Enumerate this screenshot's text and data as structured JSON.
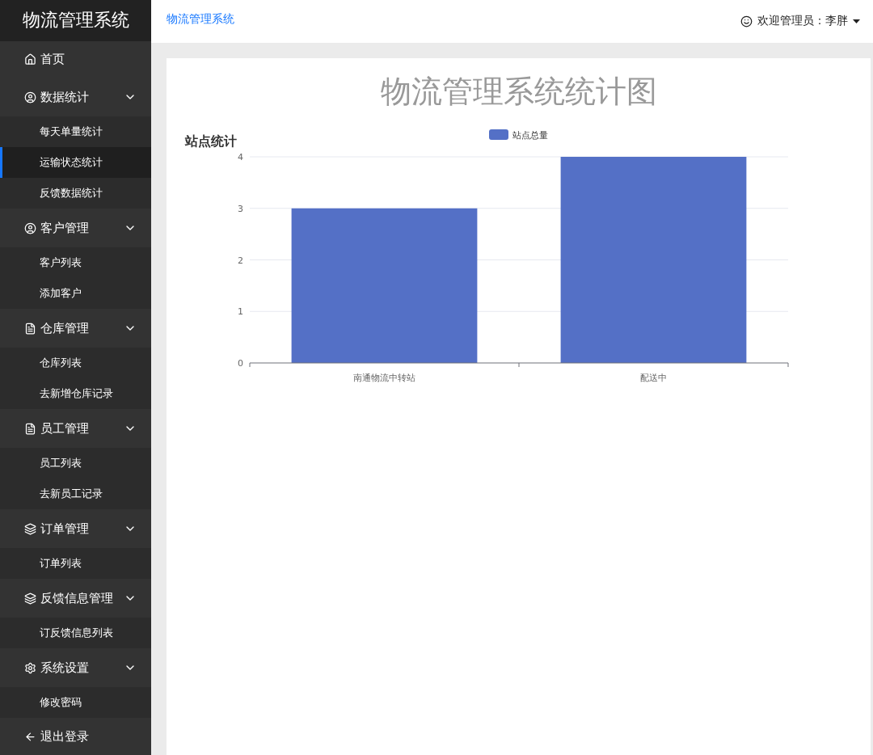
{
  "sidebar": {
    "logo": "物流管理系统",
    "items": [
      {
        "kind": "link",
        "label": "首页"
      },
      {
        "kind": "group",
        "label": "数据统计",
        "expanded": true,
        "children": [
          {
            "label": "每天单量统计",
            "selected": false
          },
          {
            "label": "运输状态统计",
            "selected": true
          },
          {
            "label": "反馈数据统计",
            "selected": false
          }
        ]
      },
      {
        "kind": "group",
        "label": "客户管理",
        "expanded": true,
        "children": [
          {
            "label": "客户列表",
            "selected": false
          },
          {
            "label": "添加客户",
            "selected": false
          }
        ]
      },
      {
        "kind": "group",
        "label": "仓库管理",
        "expanded": true,
        "children": [
          {
            "label": "仓库列表",
            "selected": false
          },
          {
            "label": "去新增仓库记录",
            "selected": false
          }
        ]
      },
      {
        "kind": "group",
        "label": "员工管理",
        "expanded": true,
        "children": [
          {
            "label": "员工列表",
            "selected": false
          },
          {
            "label": "去新员工记录",
            "selected": false
          }
        ]
      },
      {
        "kind": "group",
        "label": "订单管理",
        "expanded": true,
        "children": [
          {
            "label": "订单列表",
            "selected": false
          }
        ]
      },
      {
        "kind": "group",
        "label": "反馈信息管理",
        "expanded": true,
        "children": [
          {
            "label": "订反馈信息列表",
            "selected": false
          }
        ]
      },
      {
        "kind": "group",
        "label": "系统设置",
        "expanded": true,
        "children": [
          {
            "label": "修改密码",
            "selected": false
          }
        ]
      },
      {
        "kind": "link",
        "label": "退出登录"
      }
    ]
  },
  "header": {
    "breadcrumb": "物流管理系统",
    "user": "欢迎管理员：李胖"
  },
  "page": {
    "title": "物流管理系统统计图",
    "chart_data": {
      "type": "bar",
      "title": "站点统计",
      "categories": [
        "南通物流中转站",
        "配送中"
      ],
      "series": [
        {
          "name": "站点总量",
          "color": "#5470c6",
          "values": [
            3,
            4
          ]
        }
      ],
      "ylim": [
        0,
        4
      ],
      "grid": true,
      "yticks": [
        0,
        1,
        2,
        3,
        4
      ]
    }
  }
}
